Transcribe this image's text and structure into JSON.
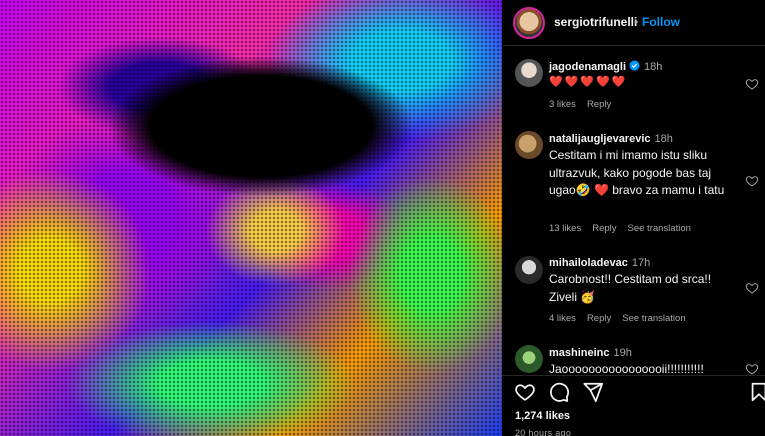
{
  "post": {
    "username": "sergiotrifunelli",
    "separator": "•",
    "follow_label": "Follow"
  },
  "comments": [
    {
      "username": "jagodenamagli",
      "verified": true,
      "time": "18h",
      "text": "❤️❤️❤️❤️❤️",
      "likes": "3 likes",
      "reply": "Reply",
      "translate": ""
    },
    {
      "username": "natalijaugljevarevic",
      "time": "18h",
      "text": "Cestitam i mi imamo istu sliku ultrazvuk, kako pogode bas taj ugao🤣 ❤️ bravo za mamu i tatu",
      "likes": "13 likes",
      "reply": "Reply",
      "translate": "See translation"
    },
    {
      "username": "mihailoladevac",
      "time": "17h",
      "text": "Carobnost!! Cestitam od srca!! Ziveli 🥳",
      "likes": "4 likes",
      "reply": "Reply",
      "translate": "See translation"
    },
    {
      "username": "mashineinc",
      "time": "19h",
      "text": "Jaoooooooooooooooii!!!!!!!!!!!",
      "likes": "",
      "reply": "",
      "translate": ""
    }
  ],
  "footer": {
    "likes": "1,274 likes",
    "posted": "20 hours ago"
  },
  "colors": {
    "accent": "#0095f6",
    "muted": "#a8a8a8",
    "like_red": "#ff3040"
  },
  "icons": [
    "heart-icon",
    "comment-icon",
    "share-icon",
    "bookmark-icon",
    "verified-icon"
  ]
}
